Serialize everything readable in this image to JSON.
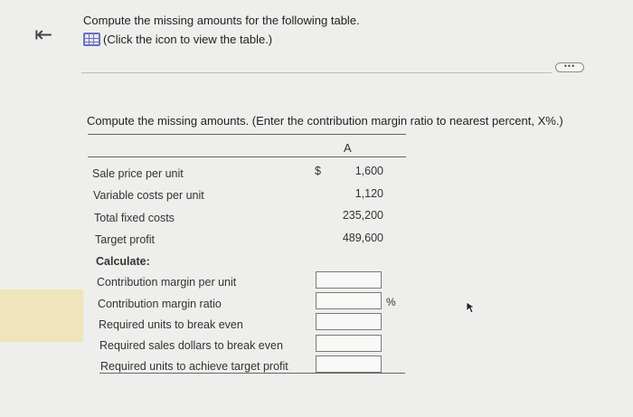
{
  "nav": {
    "back_glyph": "⇤"
  },
  "intro": {
    "heading": "Compute the missing amounts for the following table.",
    "table_link": "(Click the icon to view the table.)"
  },
  "more_button": {
    "label": "•••"
  },
  "instructions": "Compute the missing amounts. (Enter the contribution margin ratio to nearest percent, X%.)",
  "table": {
    "column_header": "A",
    "currency_symbol": "$",
    "given_rows": [
      {
        "label": "Sale price per unit",
        "value": "1,600"
      },
      {
        "label": "Variable costs per unit",
        "value": "1,120"
      },
      {
        "label": "Total fixed costs",
        "value": "235,200"
      },
      {
        "label": "Target profit",
        "value": "489,600"
      }
    ],
    "calculate_label": "Calculate:",
    "calc_rows": [
      {
        "label": "Contribution margin per unit",
        "value": "",
        "suffix": ""
      },
      {
        "label": "Contribution margin ratio",
        "value": "",
        "suffix": "%"
      },
      {
        "label": "Required units to break even",
        "value": "",
        "suffix": ""
      },
      {
        "label": "Required sales dollars to break even",
        "value": "",
        "suffix": ""
      },
      {
        "label": "Required units to achieve target profit",
        "value": "",
        "suffix": ""
      }
    ]
  },
  "colors": {
    "background": "#eeeeec",
    "highlight": "#efe4bb",
    "icon": "#6f6fbf"
  }
}
